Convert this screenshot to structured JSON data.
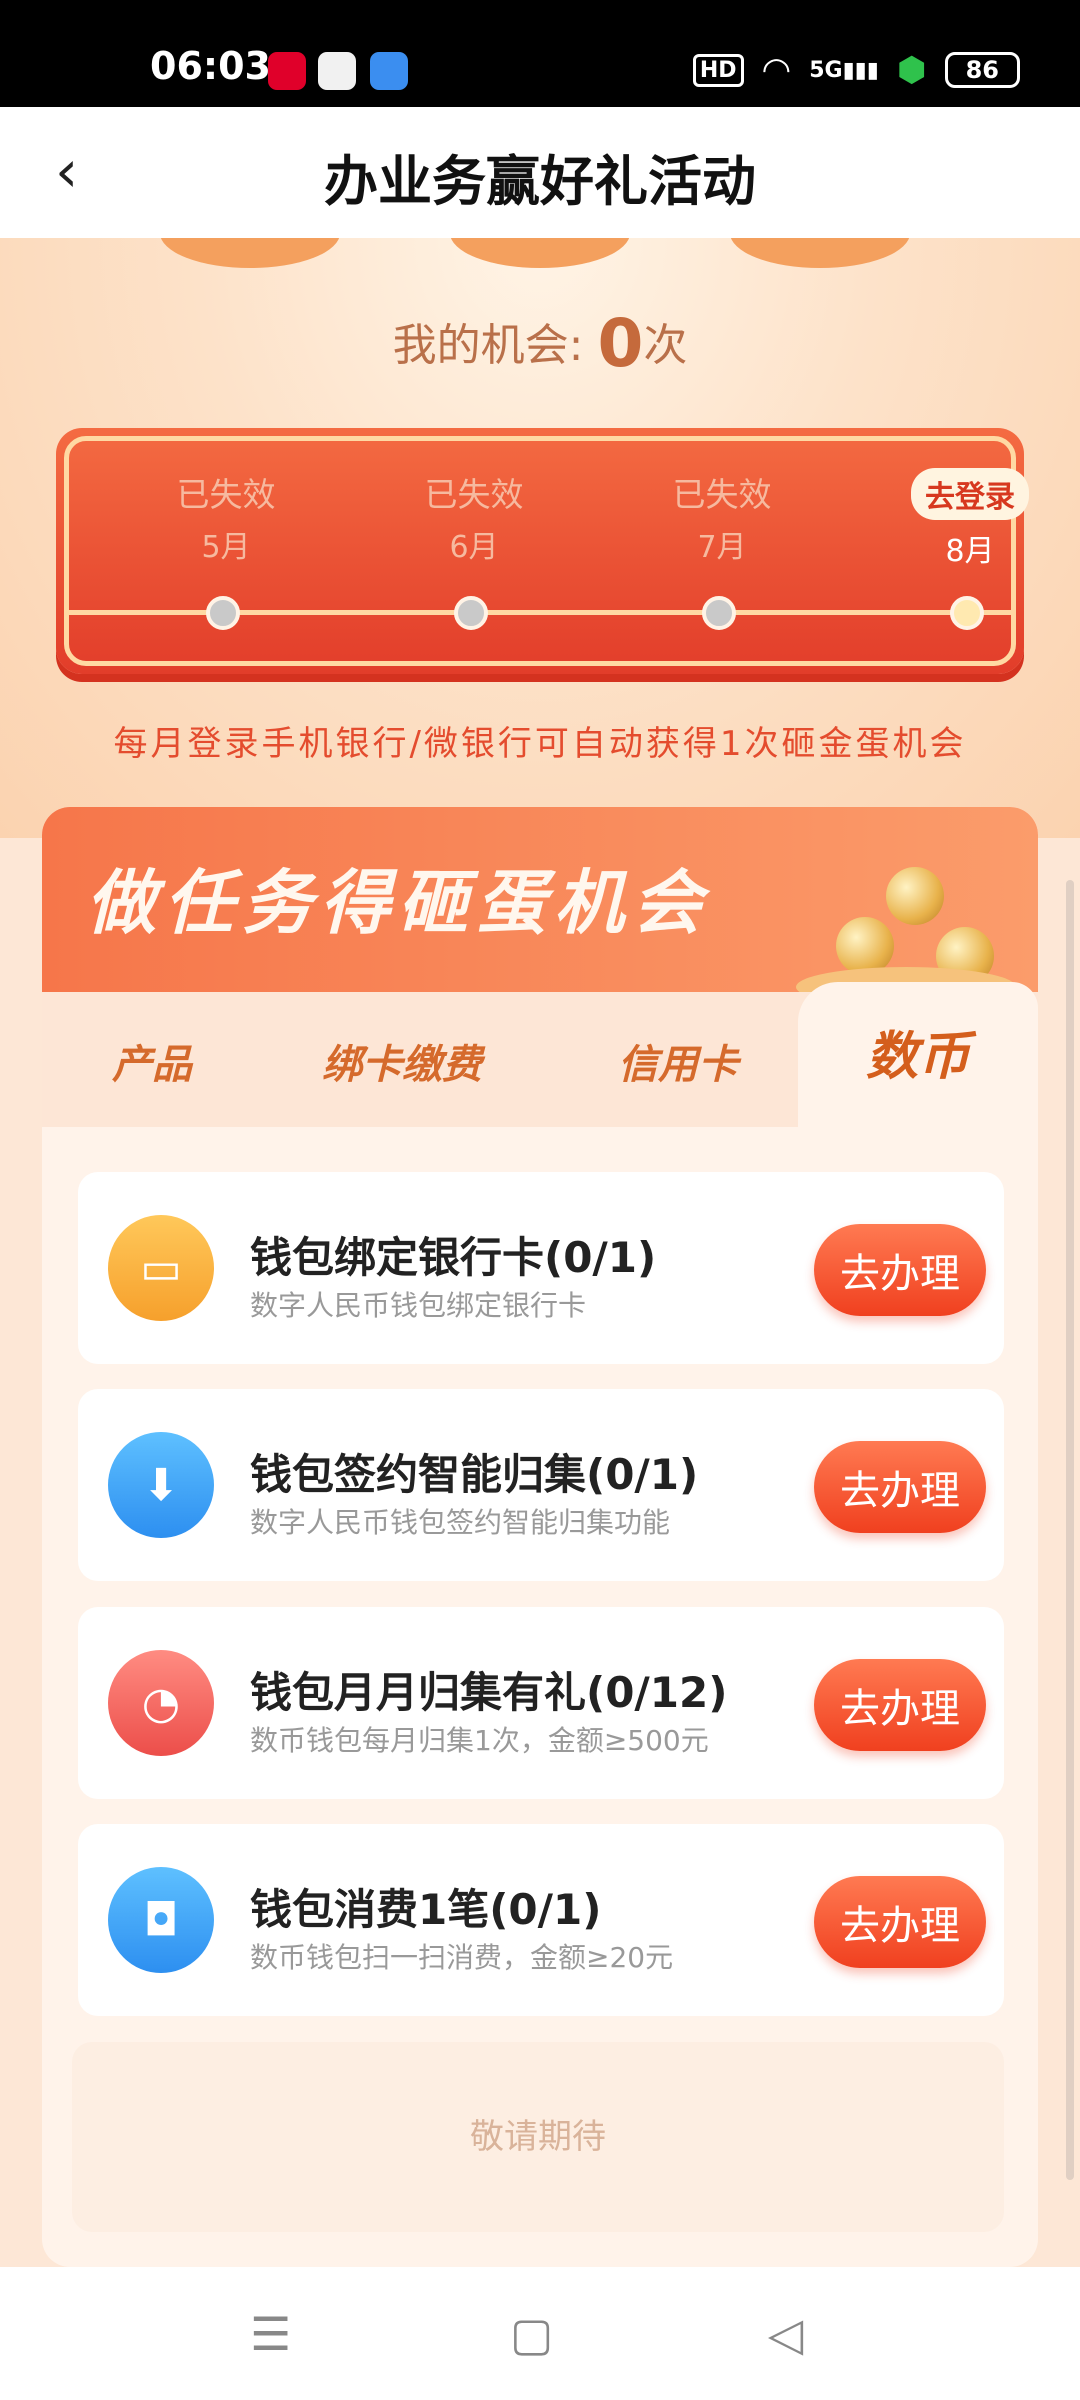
{
  "status_bar": {
    "time": "06:03",
    "hd": "HD",
    "network": "5G",
    "battery": "86"
  },
  "nav": {
    "title": "办业务赢好礼活动"
  },
  "hero": {
    "chance_label": "我的机会:",
    "chance_count": "0",
    "chance_unit": "次"
  },
  "timeline": [
    {
      "status": "已失效",
      "month": "5月",
      "active": false
    },
    {
      "status": "已失效",
      "month": "6月",
      "active": false
    },
    {
      "status": "已失效",
      "month": "7月",
      "active": false
    },
    {
      "status": "去登录",
      "month": "8月",
      "active": true
    }
  ],
  "hint": "每月登录手机银行/微银行可自动获得1次砸金蛋机会",
  "panel": {
    "title": "做任务得砸蛋机会",
    "tabs": [
      "产品",
      "绑卡缴费",
      "信用卡",
      "数币"
    ],
    "active_tab": "数币",
    "tasks": [
      {
        "title": "钱包绑定银行卡(0/1)",
        "subtitle": "数字人民币钱包绑定银行卡",
        "button": "去办理",
        "icon": "card-link-icon",
        "color": "#f9b13c"
      },
      {
        "title": "钱包签约智能归集(0/1)",
        "subtitle": "数字人民币钱包签约智能归集功能",
        "button": "去办理",
        "icon": "box-download-icon",
        "color": "#3aa5f0"
      },
      {
        "title": "钱包月月归集有礼(0/12)",
        "subtitle": "数币钱包每月归集1次，金额≥500元",
        "button": "去办理",
        "icon": "calendar-return-icon",
        "color": "#f0605a"
      },
      {
        "title": "钱包消费1笔(0/1)",
        "subtitle": "数币钱包扫一扫消费，金额≥20元",
        "button": "去办理",
        "icon": "shopping-bag-icon",
        "color": "#3aa5f0"
      }
    ],
    "coming_soon": "敬请期待"
  }
}
